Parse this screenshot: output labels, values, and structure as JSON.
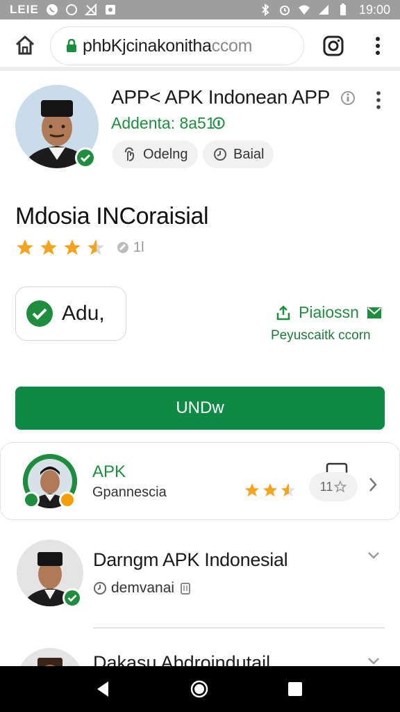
{
  "status_bar": {
    "carrier": "LEIE",
    "time": "19:00",
    "icons": [
      "whatsapp-icon",
      "compass-icon",
      "signal-off-icon",
      "notification-icon",
      "bluetooth-icon",
      "alarm-icon",
      "wifi-icon",
      "cell-signal-icon",
      "battery-icon"
    ]
  },
  "browser": {
    "url_main": "phbKjcinakonitha",
    "url_suffix": "ccom"
  },
  "app": {
    "title": "APP< APK Indonean APP",
    "developer": "Addenta: 8a51",
    "chips": [
      {
        "label": "Odelng",
        "icon": "touch-icon"
      },
      {
        "label": "Baial",
        "icon": "clock-icon"
      }
    ],
    "section_title": "Mdosia INCoraisial",
    "rating_stars": 3.5,
    "rating_extra": "1l",
    "added_label": "Adu,",
    "permission_link": "Piaiossn",
    "permission_sub": "Peyuscaitk ccorn",
    "install_label": "UNDw"
  },
  "list": [
    {
      "title": "APK",
      "subtitle": "Gpannescia",
      "stars": 2.5,
      "pill_label": "11"
    },
    {
      "title": "Darngm APK Indonesial",
      "subtitle": "demvanai"
    },
    {
      "title": "Dakasu Abdroindutail"
    }
  ],
  "colors": {
    "accent_green": "#0f8a45",
    "text_green": "#1e8e3e",
    "star": "#f4a41c",
    "status_bar": "#9e9e9e",
    "nav_bar": "#000000"
  }
}
